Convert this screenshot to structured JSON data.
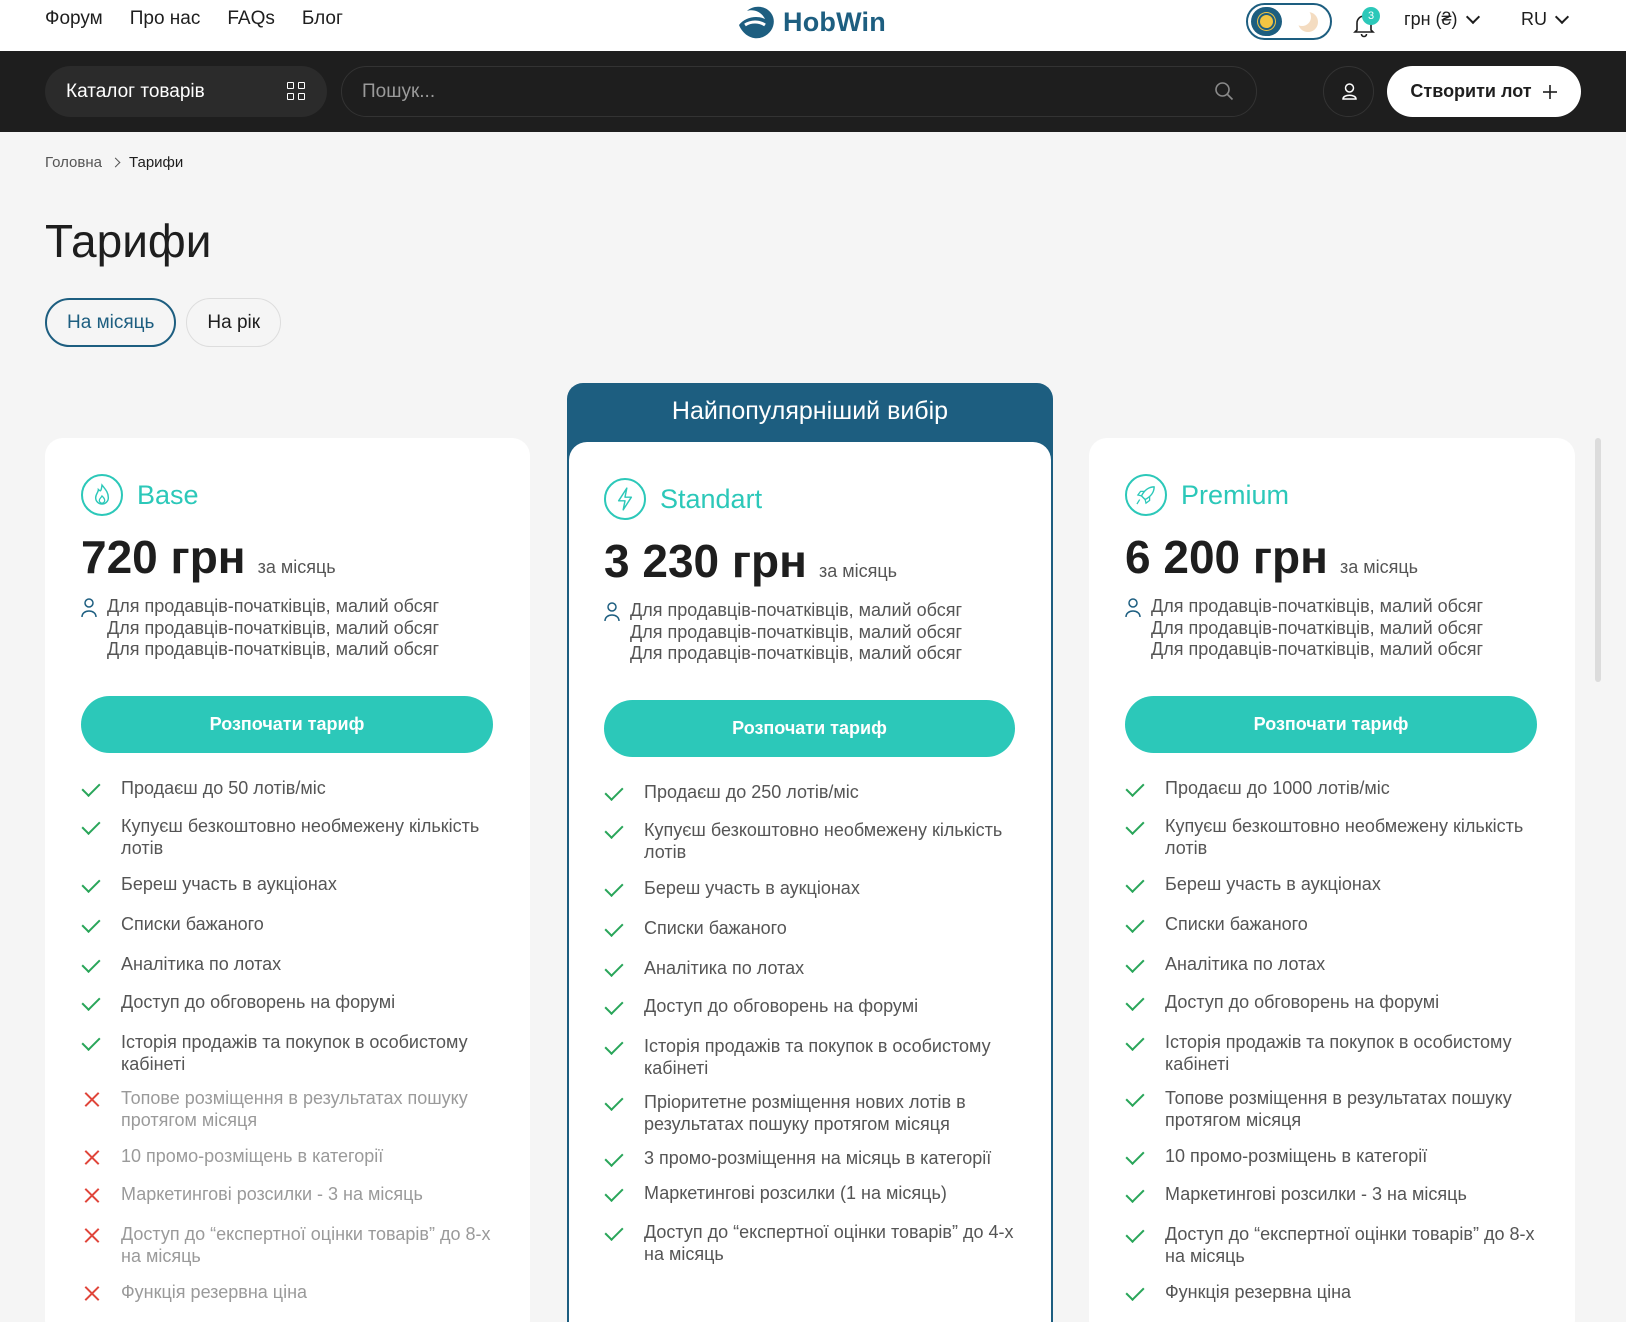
{
  "topnav": {
    "links": [
      "Форум",
      "Про нас",
      "FAQs",
      "Блог"
    ],
    "logo_text": "HobWin",
    "notifications_count": "3",
    "currency": "грн (₴)",
    "language": "RU"
  },
  "toolbar": {
    "catalog_label": "Каталог товарів",
    "search_placeholder": "Пошук...",
    "create_label": "Створити лот"
  },
  "breadcrumb": {
    "home": "Головна",
    "current": "Тарифи"
  },
  "page_title": "Тарифи",
  "period_tabs": [
    {
      "label": "На місяць",
      "active": true
    },
    {
      "label": "На рік",
      "active": false
    }
  ],
  "popular_label": "Найпопулярніший вибір",
  "plans": [
    {
      "name": "Base",
      "icon": "flame-icon",
      "price": "720 грн",
      "per": "за місяць",
      "audience": [
        "Для продавців-початківців, малий обсяг",
        "Для продавців-початківців, малий обсяг",
        "Для продавців-початківців, малий обсяг"
      ],
      "button": "Розпочати тариф",
      "features": [
        {
          "text": "Продаєш до 50 лотів/міс",
          "included": true
        },
        {
          "text": "Купуєш безкоштовно необмежену кількість лотів",
          "included": true
        },
        {
          "text": "Береш участь в аукціонах",
          "included": true
        },
        {
          "text": "Списки бажаного",
          "included": true
        },
        {
          "text": "Аналітика по лотах",
          "included": true
        },
        {
          "text": "Доступ до обговорень на форумі",
          "included": true
        },
        {
          "text": "Історія продажів та покупок в особистому кабінеті",
          "included": true
        },
        {
          "text": "Топове розміщення в результатах пошуку протягом місяця",
          "included": false
        },
        {
          "text": "10 промо-розміщень в категорії",
          "included": false
        },
        {
          "text": "Маркетингові розсилки - 3 на місяць",
          "included": false
        },
        {
          "text": "Доступ до “експертної оцінки товарів” до 8-х на місяць",
          "included": false
        },
        {
          "text": "Функція резервна ціна",
          "included": false
        }
      ]
    },
    {
      "name": "Standart",
      "icon": "lightning-icon",
      "price": "3 230 грн",
      "per": "за місяць",
      "audience": [
        "Для продавців-початківців, малий обсяг",
        "Для продавців-початківців, малий обсяг",
        "Для продавців-початківців, малий обсяг"
      ],
      "button": "Розпочати тариф",
      "features": [
        {
          "text": "Продаєш до 250 лотів/міс",
          "included": true
        },
        {
          "text": "Купуєш безкоштовно необмежену кількість лотів",
          "included": true
        },
        {
          "text": "Береш участь в аукціонах",
          "included": true
        },
        {
          "text": "Списки бажаного",
          "included": true
        },
        {
          "text": "Аналітика по лотах",
          "included": true
        },
        {
          "text": "Доступ до обговорень на форумі",
          "included": true
        },
        {
          "text": "Історія продажів та покупок в особистому кабінеті",
          "included": true
        },
        {
          "text": "Пріоритетне розміщення нових лотів в результатах пошуку протягом місяця",
          "included": true
        },
        {
          "text": "3 промо-розміщення на місяць в категорії",
          "included": true
        },
        {
          "text": "Маркетингові розсилки (1 на місяць)",
          "included": true
        },
        {
          "text": "Доступ до “експертної оцінки товарів” до 4-х на місяць",
          "included": true
        }
      ]
    },
    {
      "name": "Premium",
      "icon": "rocket-icon",
      "price": "6 200 грн",
      "per": "за місяць",
      "audience": [
        "Для продавців-початківців, малий обсяг",
        "Для продавців-початківців, малий обсяг",
        "Для продавців-початківців, малий обсяг"
      ],
      "button": "Розпочати тариф",
      "features": [
        {
          "text": "Продаєш до 1000 лотів/міс",
          "included": true
        },
        {
          "text": "Купуєш безкоштовно необмежену кількість лотів",
          "included": true
        },
        {
          "text": "Береш участь в аукціонах",
          "included": true
        },
        {
          "text": "Списки бажаного",
          "included": true
        },
        {
          "text": "Аналітика по лотах",
          "included": true
        },
        {
          "text": "Доступ до обговорень на форумі",
          "included": true
        },
        {
          "text": "Історія продажів та покупок в особистому кабінеті",
          "included": true
        },
        {
          "text": "Топове розміщення в результатах пошуку протягом місяця",
          "included": true
        },
        {
          "text": "10 промо-розміщень в категорії",
          "included": true
        },
        {
          "text": "Маркетингові розсилки - 3 на місяць",
          "included": true
        },
        {
          "text": "Доступ до “експертної оцінки товарів” до 8-х на місяць",
          "included": true
        },
        {
          "text": "Функція резервна ціна",
          "included": true
        }
      ]
    }
  ],
  "colors": {
    "brand": "#1d5e80",
    "accent": "#2cc8b9",
    "check": "#2aa65a",
    "cross": "#e0453a"
  }
}
